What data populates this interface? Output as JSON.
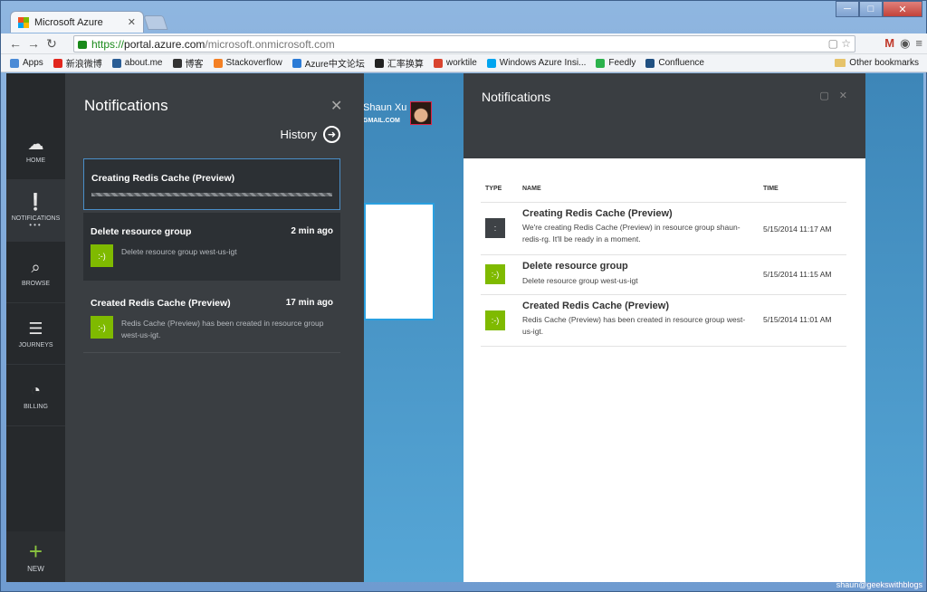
{
  "browser": {
    "tab_title": "Microsoft Azure",
    "url_secure": "https://",
    "url_host": "portal.azure.com",
    "url_path": "/microsoft.onmicrosoft.com"
  },
  "bookmarks": [
    {
      "label": "Apps",
      "color": "#4a8ad6"
    },
    {
      "label": "新浪微博",
      "color": "#e2261d"
    },
    {
      "label": "about.me",
      "color": "#2a5d95"
    },
    {
      "label": "博客",
      "color": "#333333"
    },
    {
      "label": "Stackoverflow",
      "color": "#f48024"
    },
    {
      "label": "Azure中文论坛",
      "color": "#2b7bd6"
    },
    {
      "label": "汇率换算",
      "color": "#222222"
    },
    {
      "label": "worktile",
      "color": "#d9442f"
    },
    {
      "label": "Windows Azure Insi...",
      "color": "#00a4ef"
    },
    {
      "label": "Feedly",
      "color": "#2bb24c"
    },
    {
      "label": "Confluence",
      "color": "#205081"
    }
  ],
  "other_bookmarks": "Other bookmarks",
  "nav": {
    "home": "HOME",
    "notifications": "NOTIFICATIONS",
    "browse": "BROWSE",
    "journeys": "JOURNEYS",
    "billing": "BILLING",
    "new": "NEW"
  },
  "flyout": {
    "title": "Notifications",
    "history": "History",
    "items": [
      {
        "title": "Creating Redis Cache (Preview)",
        "time": "",
        "desc": "",
        "badge": ""
      },
      {
        "title": "Delete resource group",
        "time": "2 min ago",
        "desc": "Delete resource group west-us-igt",
        "badge": ":-)"
      },
      {
        "title": "Created Redis Cache (Preview)",
        "time": "17 min ago",
        "desc": "Redis Cache (Preview) has been created in resource group west-us-igt.",
        "badge": ":-)"
      }
    ]
  },
  "user": {
    "name": "Shaun Xu",
    "sub": "GMAIL.COM"
  },
  "blade": {
    "title": "Notifications",
    "columns": {
      "type": "TYPE",
      "name": "NAME",
      "time": "TIME"
    },
    "rows": [
      {
        "name": "Creating Redis Cache (Preview)",
        "desc": "We're creating Redis Cache (Preview) in resource group shaun-redis-rg. It'll be ready in a moment.",
        "time": "5/15/2014 11:17 AM",
        "icon": ":"
      },
      {
        "name": "Delete resource group",
        "desc": "Delete resource group west-us-igt",
        "time": "5/15/2014 11:15 AM",
        "icon": ":-)"
      },
      {
        "name": "Created Redis Cache (Preview)",
        "desc": "Redis Cache (Preview) has been created in resource group west-us-igt.",
        "time": "5/15/2014 11:01 AM",
        "icon": ":-)"
      }
    ]
  },
  "watermark": "shaun@geekswithblogs"
}
